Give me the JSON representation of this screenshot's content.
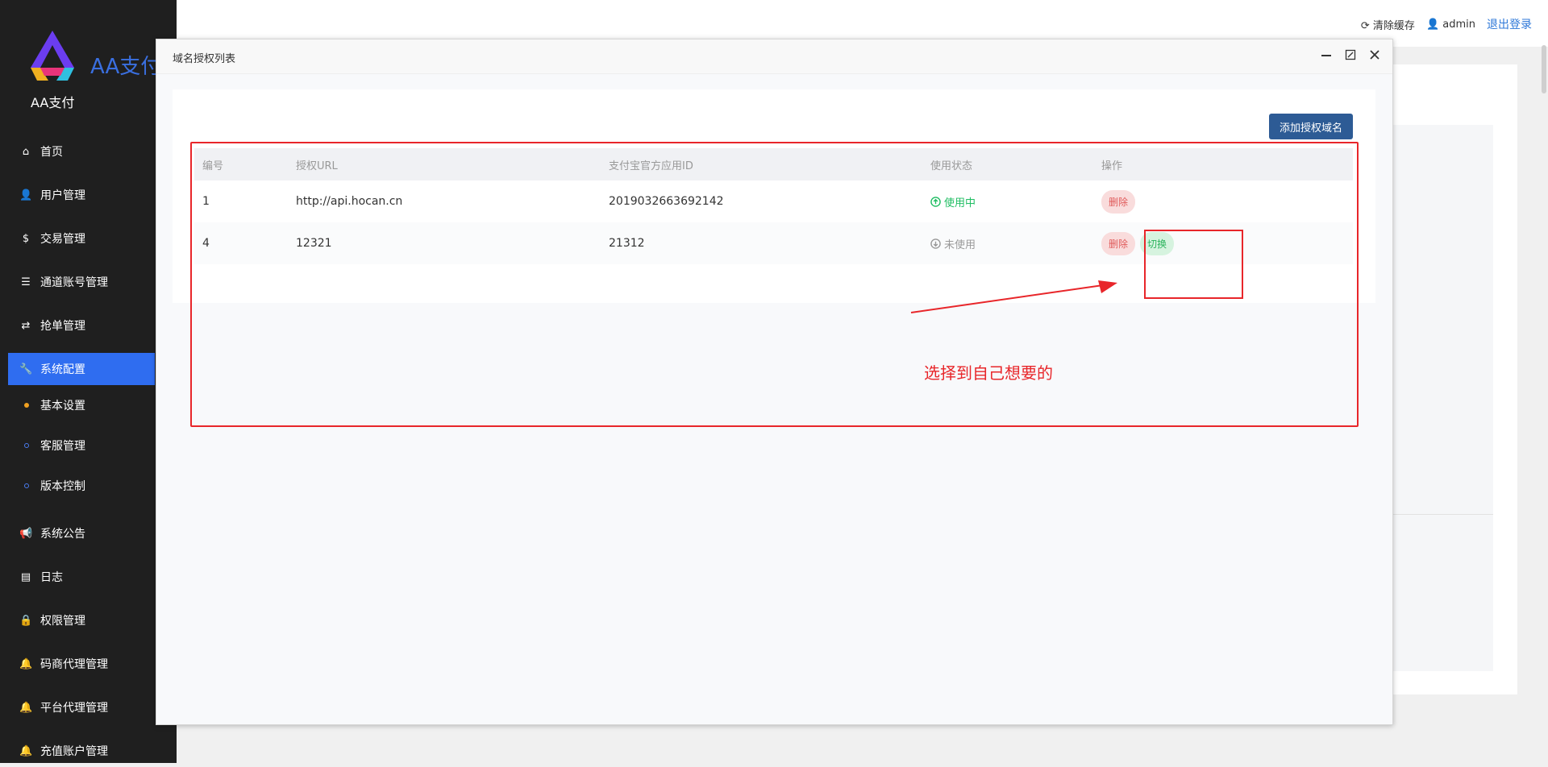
{
  "app": {
    "logo_title": "AA支付",
    "logo_sub": "AA支付"
  },
  "sidebar": {
    "items": [
      {
        "icon": "home-icon",
        "glyph": "⌂",
        "label": "首页"
      },
      {
        "icon": "user-icon",
        "glyph": "👤",
        "label": "用户管理"
      },
      {
        "icon": "dollar-icon",
        "glyph": "$",
        "label": "交易管理"
      },
      {
        "icon": "list-icon",
        "glyph": "☰",
        "label": "通道账号管理"
      },
      {
        "icon": "exchange-icon",
        "glyph": "⇄",
        "label": "抢单管理"
      },
      {
        "icon": "wrench-icon",
        "glyph": "🔧",
        "label": "系统配置"
      },
      {
        "icon": "bullhorn-icon",
        "glyph": "📢",
        "label": "系统公告"
      },
      {
        "icon": "log-icon",
        "glyph": "▤",
        "label": "日志"
      },
      {
        "icon": "lock-icon",
        "glyph": "🔒",
        "label": "权限管理"
      },
      {
        "icon": "bell-icon",
        "glyph": "🔔",
        "label": "码商代理管理"
      },
      {
        "icon": "bell-icon",
        "glyph": "🔔",
        "label": "平台代理管理"
      },
      {
        "icon": "bell-icon",
        "glyph": "🔔",
        "label": "充值账户管理"
      }
    ],
    "sub_items": [
      {
        "label": "基本设置"
      },
      {
        "label": "客服管理"
      },
      {
        "label": "版本控制"
      }
    ]
  },
  "topbar": {
    "clear_cache": "清除缓存",
    "username": "admin",
    "logout": "退出登录"
  },
  "modal": {
    "title": "域名授权列表",
    "add_button": "添加授权域名",
    "table": {
      "headers": [
        "编号",
        "授权URL",
        "支付宝官方应用ID",
        "使用状态",
        "操作"
      ],
      "rows": [
        {
          "id": "1",
          "url": "http://api.hocan.cn",
          "app_id": "2019032663692142",
          "status": "使用中",
          "status_active": true,
          "delete": "删除",
          "switch": ""
        },
        {
          "id": "4",
          "url": "12321",
          "app_id": "21312",
          "status": "未使用",
          "status_active": false,
          "delete": "删除",
          "switch": "切换"
        }
      ]
    }
  },
  "annotation": {
    "text": "选择到自己想要的",
    "color": "#e8262a"
  },
  "colors": {
    "sidebar_bg": "#1f1f1f",
    "active_nav": "#2f6df0",
    "primary_button": "#2d5b95"
  }
}
